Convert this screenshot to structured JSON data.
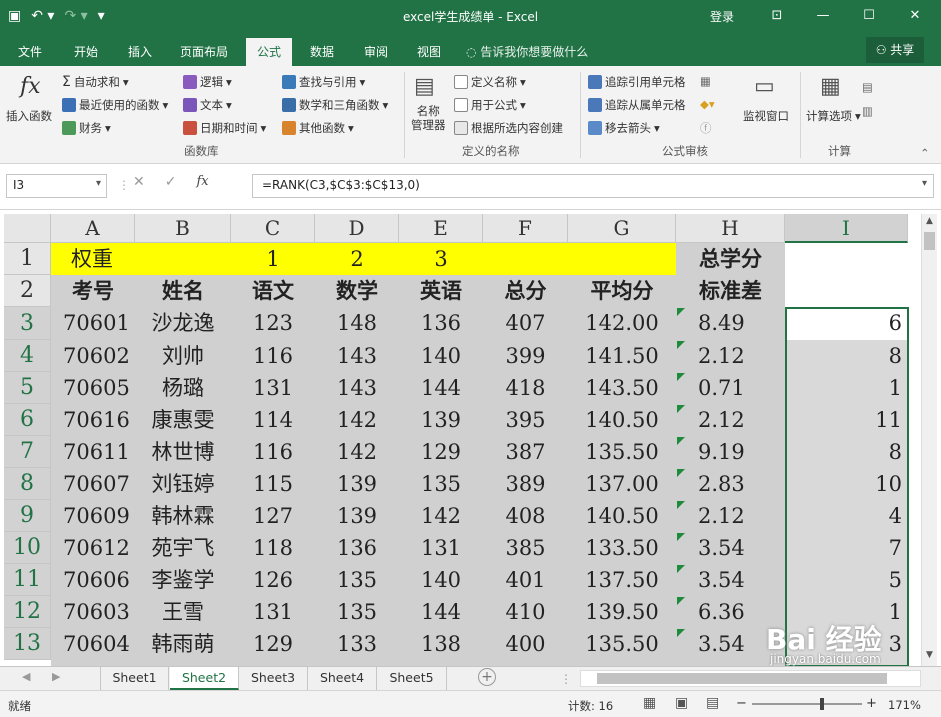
{
  "titlebar": {
    "title": "excel学生成绩单 - Excel",
    "login": "登录",
    "icons": [
      "save-icon",
      "undo-icon",
      "redo-icon",
      "customize-qat-icon",
      "ribbon-display-icon",
      "minimize-icon",
      "maximize-icon",
      "close-icon"
    ]
  },
  "tabs": [
    "文件",
    "开始",
    "插入",
    "页面布局",
    "公式",
    "数据",
    "审阅",
    "视图"
  ],
  "active_tab": "公式",
  "tell_me": "告诉我你想要做什么",
  "share": "共享",
  "ribbon": {
    "insert_function": "插入函数",
    "autosum": "自动求和",
    "recent": "最近使用的函数",
    "financial": "财务",
    "logical": "逻辑",
    "text": "文本",
    "datetime": "日期和时间",
    "lookup": "查找与引用",
    "math": "数学和三角函数",
    "more": "其他函数",
    "group_library": "函数库",
    "name_manager": "名称\n管理器",
    "define_name": "定义名称",
    "use_in_formula": "用于公式",
    "create_from_selection": "根据所选内容创建",
    "group_names": "定义的名称",
    "trace_precedents": "追踪引用单元格",
    "trace_dependents": "追踪从属单元格",
    "remove_arrows": "移去箭头",
    "group_audit": "公式审核",
    "watch_window": "监视窗口",
    "calc_options": "计算选项",
    "group_calc": "计算"
  },
  "formula_bar": {
    "name_box": "I3",
    "formula": "=RANK(C3,$C$3:$C$13,0)"
  },
  "sheet": {
    "columns": [
      "A",
      "B",
      "C",
      "D",
      "E",
      "F",
      "G",
      "H",
      "I"
    ],
    "selected_column": "I",
    "rows": [
      "1",
      "2",
      "3",
      "4",
      "5",
      "6",
      "7",
      "8",
      "9",
      "10",
      "11",
      "12",
      "13"
    ],
    "row1": {
      "A": "权重",
      "C": "1",
      "D": "2",
      "E": "3",
      "H": "总学分"
    },
    "headers": [
      "考号",
      "姓名",
      "语文",
      "数学",
      "英语",
      "总分",
      "平均分",
      "标准差"
    ],
    "data": [
      [
        "70601",
        "沙龙逸",
        "123",
        "148",
        "136",
        "407",
        "142.00",
        "8.49",
        "6"
      ],
      [
        "70602",
        "刘帅",
        "116",
        "143",
        "140",
        "399",
        "141.50",
        "2.12",
        "8"
      ],
      [
        "70605",
        "杨璐",
        "131",
        "143",
        "144",
        "418",
        "143.50",
        "0.71",
        "1"
      ],
      [
        "70616",
        "康惠雯",
        "114",
        "142",
        "139",
        "395",
        "140.50",
        "2.12",
        "11"
      ],
      [
        "70611",
        "林世博",
        "116",
        "142",
        "129",
        "387",
        "135.50",
        "9.19",
        "8"
      ],
      [
        "70607",
        "刘钰婷",
        "115",
        "139",
        "135",
        "389",
        "137.00",
        "2.83",
        "10"
      ],
      [
        "70609",
        "韩林霖",
        "127",
        "139",
        "142",
        "408",
        "140.50",
        "2.12",
        "4"
      ],
      [
        "70612",
        "苑宇飞",
        "118",
        "136",
        "131",
        "385",
        "133.50",
        "3.54",
        "7"
      ],
      [
        "70606",
        "李鉴学",
        "126",
        "135",
        "140",
        "401",
        "137.50",
        "3.54",
        "5"
      ],
      [
        "70603",
        "王雪",
        "131",
        "135",
        "144",
        "410",
        "139.50",
        "6.36",
        "1"
      ],
      [
        "70604",
        "韩雨萌",
        "129",
        "133",
        "138",
        "400",
        "135.50",
        "3.54",
        "3"
      ]
    ],
    "colors": {
      "yellow": "#ffff00",
      "gray": "#d0d0d0",
      "green": "#217346",
      "triangle": "#1e8a3b"
    }
  },
  "sheet_tabs": [
    "Sheet1",
    "Sheet2",
    "Sheet3",
    "Sheet4",
    "Sheet5"
  ],
  "active_sheet": "Sheet2",
  "status": {
    "ready": "就绪",
    "count": "计数: 16",
    "zoom": "171%"
  },
  "watermark": {
    "brand": "Bai 经验",
    "url": "jingyan.baidu.com"
  }
}
